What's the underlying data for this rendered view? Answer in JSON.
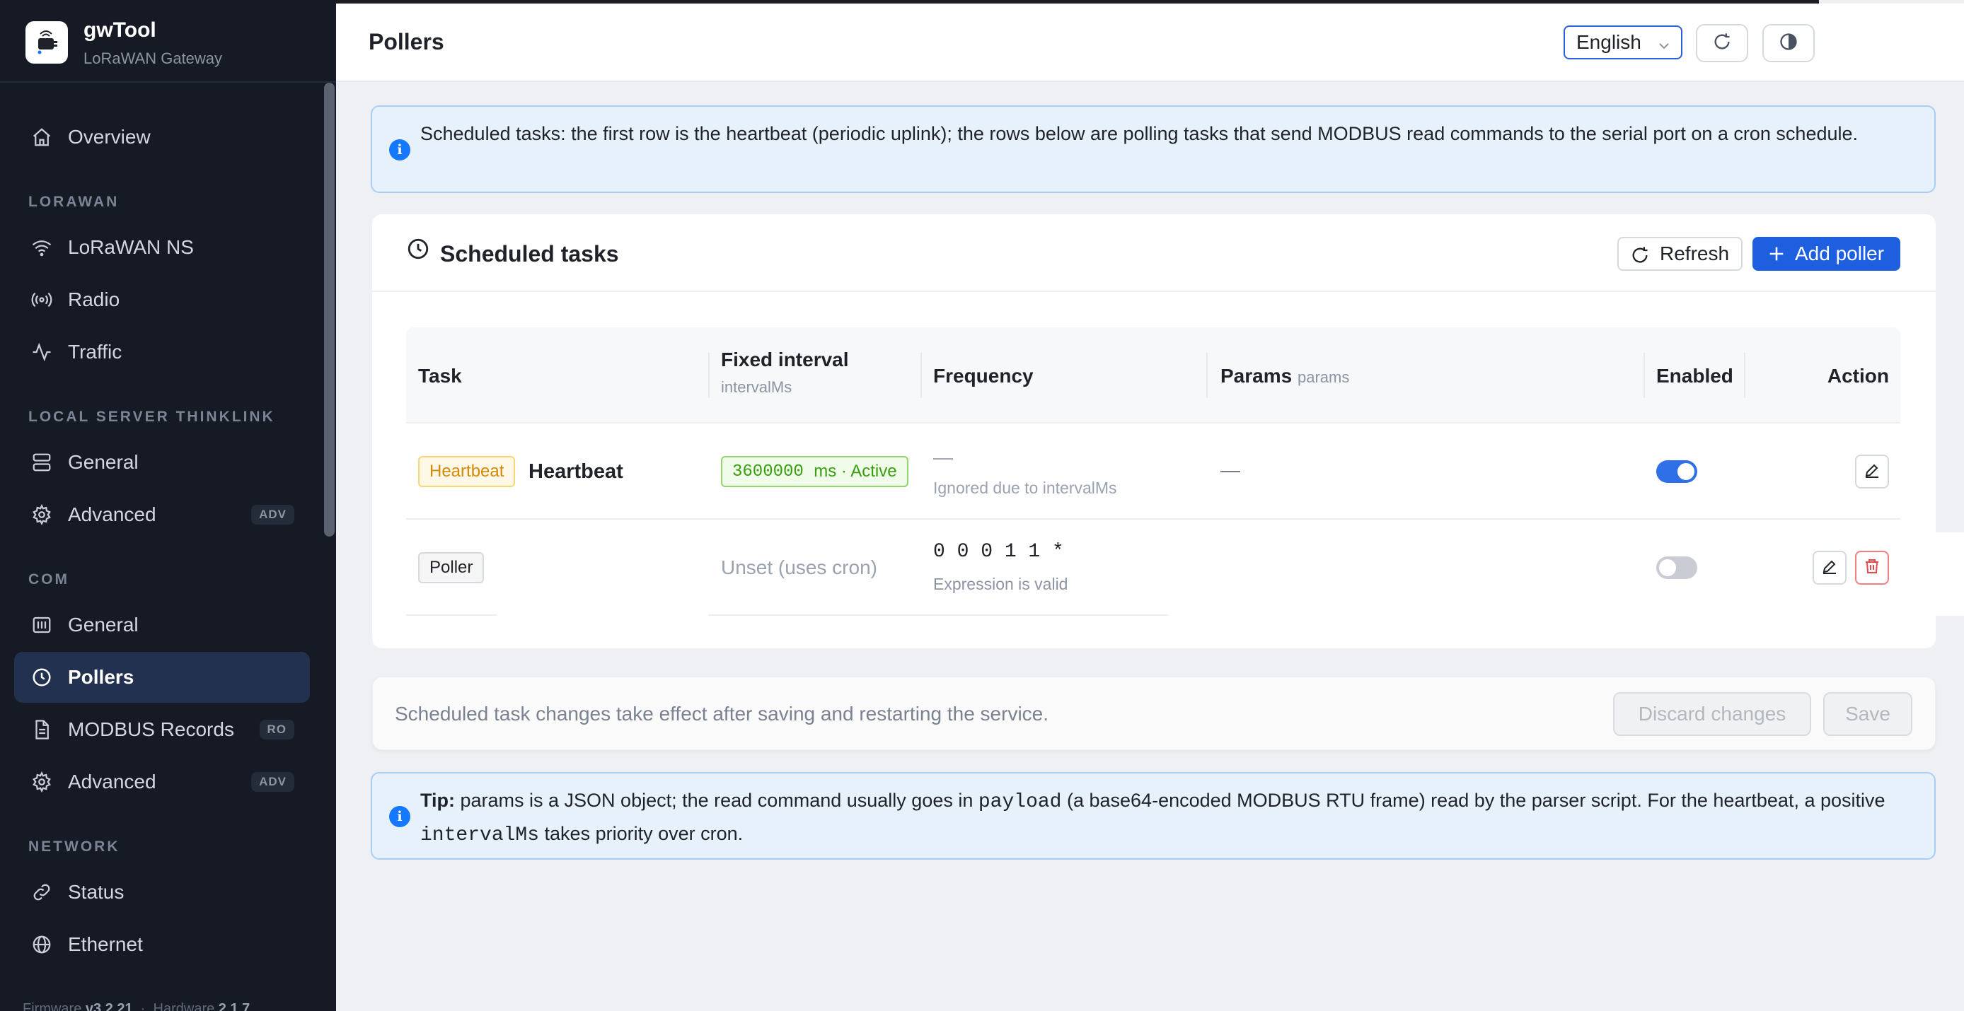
{
  "app": {
    "name": "gwTool",
    "subtitle": "LoRaWAN Gateway"
  },
  "sidebar": {
    "overview": "Overview",
    "sections": {
      "lorawan": "LORAWAN",
      "local": "LOCAL SERVER THINKLINK",
      "com": "COM",
      "network": "NETWORK"
    },
    "items": {
      "lorawan_ns": "LoRaWAN NS",
      "radio": "Radio",
      "traffic": "Traffic",
      "local_general": "General",
      "local_advanced": "Advanced",
      "local_advanced_badge": "ADV",
      "com_general": "General",
      "pollers": "Pollers",
      "modbus_records": "MODBUS Records",
      "modbus_records_badge": "RO",
      "com_advanced": "Advanced",
      "com_advanced_badge": "ADV",
      "status": "Status",
      "ethernet": "Ethernet"
    },
    "footer": {
      "firmware_label": "Firmware",
      "firmware_version": "v3.2.21",
      "hardware_label": "Hardware",
      "hardware_version": "2.1.7"
    }
  },
  "header": {
    "title": "Pollers",
    "language": "English"
  },
  "info_top": "Scheduled tasks: the first row is the heartbeat (periodic uplink); the rows below are polling tasks that send MODBUS read commands to the serial port on a cron schedule.",
  "card": {
    "title": "Scheduled tasks",
    "refresh_label": "Refresh",
    "add_label": "Add poller",
    "columns": {
      "task": "Task",
      "fixed_interval": "Fixed interval",
      "fixed_interval_sub": "intervalMs",
      "frequency": "Frequency",
      "params": "Params",
      "params_sub": "params",
      "enabled": "Enabled",
      "action": "Action"
    },
    "rows": {
      "heartbeat": {
        "tag": "Heartbeat",
        "name": "Heartbeat",
        "interval_value": "3600000",
        "interval_unit": "ms · Active",
        "frequency_value": "—",
        "frequency_note": "Ignored due to intervalMs",
        "params": "—",
        "enabled": true
      },
      "poller": {
        "tag": "Poller",
        "interval": "Unset (uses cron)",
        "frequency_value": "0 0 0 1 1 *",
        "frequency_note": "Expression is valid",
        "enabled": false
      }
    }
  },
  "savebar": {
    "text": "Scheduled task changes take effect after saving and restarting the service.",
    "discard_label": "Discard changes",
    "save_label": "Save"
  },
  "tip": {
    "bold": "Tip:",
    "part1": " params is a JSON object; the read command usually goes in ",
    "code1": "payload",
    "part2": " (a base64-encoded MODBUS RTU frame) read by the parser script. For the heartbeat, a positive ",
    "code2": "intervalMs",
    "part3": " takes priority over cron."
  },
  "colors": {
    "accent": "#1e5fe0",
    "sidebar_bg": "#151a24",
    "info_bg": "#e6f1fc",
    "danger": "#e5484d"
  }
}
